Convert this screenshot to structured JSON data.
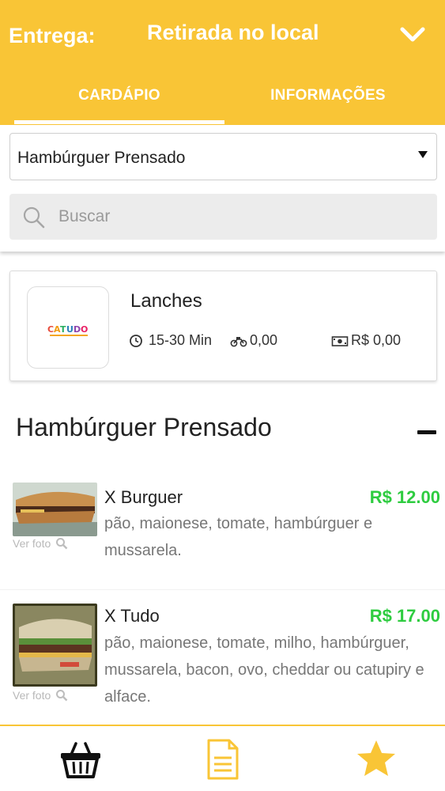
{
  "header": {
    "delivery_label": "Entrega:",
    "delivery_mode": "Retirada no local",
    "chevron_icon": "chevron-down-icon",
    "background_color": "#f9c536"
  },
  "tabs": [
    {
      "label": "CARDÁPIO",
      "active": true
    },
    {
      "label": "INFORMAÇÕES",
      "active": false
    }
  ],
  "filters": {
    "category_selected": "Hambúrguer Prensado",
    "search_placeholder": "Buscar",
    "search_value": ""
  },
  "store": {
    "name": "Lanches",
    "logo_text": "CATUDO",
    "delivery_time": "15-30 Min",
    "delivery_fee": "0,00",
    "minimum_order": "R$ 0,00"
  },
  "section": {
    "title": "Hambúrguer Prensado",
    "collapse_icon": "minus-icon"
  },
  "products": [
    {
      "name": "X Burguer",
      "price": "R$ 12.00",
      "description": "pão, maionese, tomate, hambúrguer e mussarela.",
      "view_photo_label": "Ver foto"
    },
    {
      "name": "X Tudo",
      "price": "R$ 17.00",
      "description": "pão, maionese, tomate, milho, hambúrguer, mussarela, bacon, ovo, cheddar ou catupiry e alface.",
      "view_photo_label": "Ver foto"
    }
  ],
  "bottom_nav": [
    {
      "icon": "basket-icon"
    },
    {
      "icon": "document-icon"
    },
    {
      "icon": "star-icon"
    }
  ],
  "colors": {
    "accent": "#f9c536",
    "price": "#2ecc40"
  }
}
